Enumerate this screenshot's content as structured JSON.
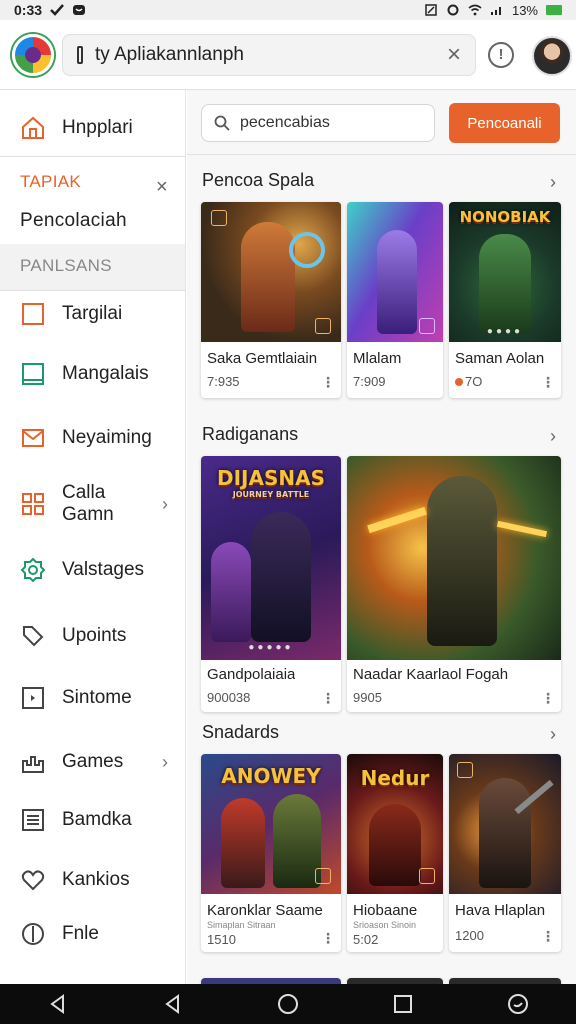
{
  "status_bar": {
    "time": "0:33",
    "battery": "13%"
  },
  "header": {
    "search_value": "ty Apliakannlanph",
    "clear_icon": "close-icon",
    "info_icon": "info-icon"
  },
  "sidebar": {
    "items_top": [
      {
        "label": "Hnpplari",
        "icon": "home-icon"
      }
    ],
    "section1": "TAPIAK",
    "section1_item": "Pencolaciah",
    "section2": "PANLSANS",
    "items": [
      {
        "label": "Targilai",
        "icon": "square-icon"
      },
      {
        "label": "Mangalais",
        "icon": "square-icon"
      },
      {
        "label": "Neyaiming",
        "icon": "mail-icon"
      },
      {
        "label": "Calla Gamn",
        "icon": "grid-icon",
        "chevron": "›"
      },
      {
        "label": "Valstages",
        "icon": "badge-icon"
      },
      {
        "label": "Upoints",
        "icon": "tag-icon"
      },
      {
        "label": "Sintome",
        "icon": "play-box-icon"
      },
      {
        "label": "Games",
        "icon": "castle-icon",
        "chevron": "›"
      },
      {
        "label": "Bamdka",
        "icon": "list-icon"
      },
      {
        "label": "Kankios",
        "icon": "heart-icon"
      },
      {
        "label": "Fnle",
        "icon": "compass-icon"
      }
    ]
  },
  "main": {
    "search_value": "pecencabias",
    "button_label": "Pencoanali",
    "sections": [
      {
        "title": "Pencoa Spala",
        "chevron": "›",
        "cards": [
          {
            "title": "Saka Gemtlaiain",
            "meta": "7:935"
          },
          {
            "title": "Mlalam",
            "meta": "7:909"
          },
          {
            "title": "Saman Aolan",
            "meta": "7O",
            "art_text": "NONOBIAK"
          }
        ]
      },
      {
        "title": "Radiganans",
        "chevron": "›",
        "cards": [
          {
            "title": "Gandpolaiaia",
            "meta": "900038",
            "art_text": "DIJASNAS",
            "art_subtext": "JOURNEY BATTLE"
          },
          {
            "title": "Naadar Kaarlaol Fogah",
            "meta": "9905"
          }
        ]
      },
      {
        "title": "Snadards",
        "chevron": "›",
        "cards": [
          {
            "title": "Karonklar Saame",
            "sub": "Simaplan Sitraan",
            "meta": "1510",
            "art_text": "ANOWEY"
          },
          {
            "title": "Hiobaane",
            "sub": "Srioason Sinoin",
            "meta": "5:02",
            "art_text": "Nedur"
          },
          {
            "title": "Hava Hlaplan",
            "meta": "1200"
          }
        ]
      }
    ]
  },
  "colors": {
    "accent": "#e8632b",
    "nav_bg": "#0c0c0c"
  }
}
